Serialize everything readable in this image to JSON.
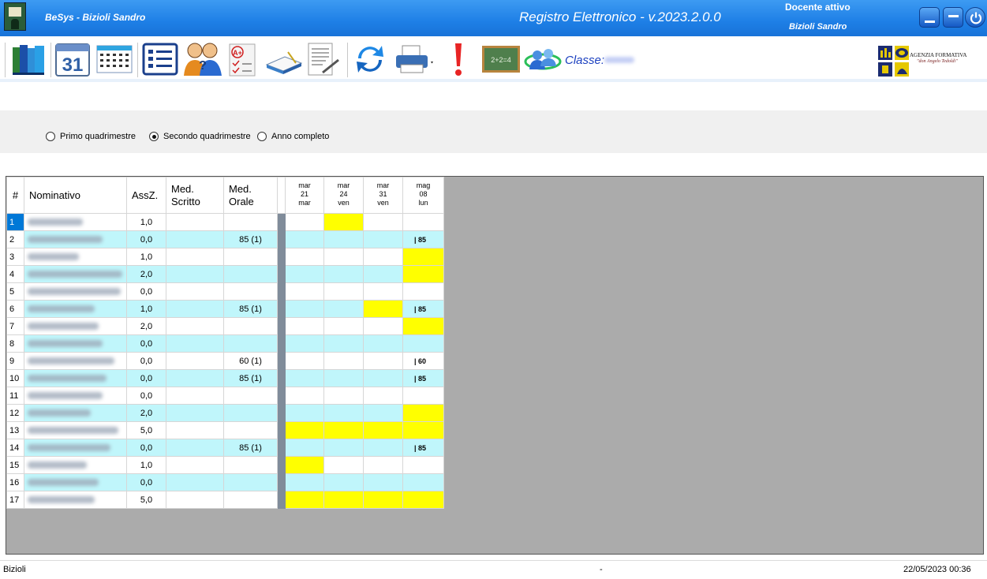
{
  "titlebar": {
    "app_name": "BeSys - Bizioli Sandro",
    "title": "Registro Elettronico - v.2023.2.0.0",
    "teacher_label": "Docente attivo",
    "teacher_name": "Bizioli Sandro"
  },
  "toolbar": {
    "icons": [
      "books-icon",
      "calendar-icon",
      "timetable-icon",
      "register-icon",
      "students-icon",
      "grades-icon",
      "open-book-icon",
      "document-sign-icon",
      "sync-icon",
      "printer-icon",
      "alert-icon",
      "blackboard-icon",
      "globe-users-icon"
    ],
    "calendar_day": "31",
    "blackboard_text": "2+2=4",
    "class_label": "Classe:",
    "org_name": "AGENZIA FORMATIVA",
    "org_subtitle": "\"don Angelo Tedoldi\""
  },
  "filters": {
    "options": [
      {
        "label": "Primo quadrimestre",
        "selected": false
      },
      {
        "label": "Secondo quadrimestre",
        "selected": true
      },
      {
        "label": "Anno completo",
        "selected": false
      }
    ]
  },
  "grid": {
    "headers": {
      "num": "#",
      "name": "Nominativo",
      "absences": "AssZ.",
      "written_1": "Med.",
      "written_2": "Scritto",
      "oral_1": "Med.",
      "oral_2": "Orale"
    },
    "dates": [
      {
        "month": "mar",
        "day": "21",
        "weekday": "mar"
      },
      {
        "month": "mar",
        "day": "24",
        "weekday": "ven"
      },
      {
        "month": "mar",
        "day": "31",
        "weekday": "ven"
      },
      {
        "month": "mag",
        "day": "08",
        "weekday": "lun"
      }
    ],
    "rows": [
      {
        "num": "1",
        "abs": "1,0",
        "written": "",
        "oral": "",
        "cells": [
          "",
          "Y",
          "",
          ""
        ]
      },
      {
        "num": "2",
        "abs": "0,0",
        "written": "",
        "oral": "85 (1)",
        "cells": [
          "",
          "",
          "",
          "| 85"
        ]
      },
      {
        "num": "3",
        "abs": "1,0",
        "written": "",
        "oral": "",
        "cells": [
          "",
          "",
          "",
          "Y"
        ]
      },
      {
        "num": "4",
        "abs": "2,0",
        "written": "",
        "oral": "",
        "cells": [
          "",
          "",
          "",
          "Y"
        ]
      },
      {
        "num": "5",
        "abs": "0,0",
        "written": "",
        "oral": "",
        "cells": [
          "",
          "",
          "",
          ""
        ]
      },
      {
        "num": "6",
        "abs": "1,0",
        "written": "",
        "oral": "85 (1)",
        "cells": [
          "",
          "",
          "Y",
          "| 85"
        ]
      },
      {
        "num": "7",
        "abs": "2,0",
        "written": "",
        "oral": "",
        "cells": [
          "",
          "",
          "",
          "Y"
        ]
      },
      {
        "num": "8",
        "abs": "0,0",
        "written": "",
        "oral": "",
        "cells": [
          "",
          "",
          "",
          ""
        ]
      },
      {
        "num": "9",
        "abs": "0,0",
        "written": "",
        "oral": "60 (1)",
        "cells": [
          "",
          "",
          "",
          "| 60"
        ]
      },
      {
        "num": "10",
        "abs": "0,0",
        "written": "",
        "oral": "85 (1)",
        "cells": [
          "",
          "",
          "",
          "| 85"
        ]
      },
      {
        "num": "11",
        "abs": "0,0",
        "written": "",
        "oral": "",
        "cells": [
          "",
          "",
          "",
          ""
        ]
      },
      {
        "num": "12",
        "abs": "2,0",
        "written": "",
        "oral": "",
        "cells": [
          "",
          "",
          "",
          "Y"
        ]
      },
      {
        "num": "13",
        "abs": "5,0",
        "written": "",
        "oral": "",
        "cells": [
          "Y",
          "Y",
          "Y",
          "Y"
        ]
      },
      {
        "num": "14",
        "abs": "0,0",
        "written": "",
        "oral": "85 (1)",
        "cells": [
          "",
          "",
          "",
          "| 85"
        ]
      },
      {
        "num": "15",
        "abs": "1,0",
        "written": "",
        "oral": "",
        "cells": [
          "Y",
          "",
          "",
          ""
        ]
      },
      {
        "num": "16",
        "abs": "0,0",
        "written": "",
        "oral": "",
        "cells": [
          "",
          "",
          "",
          ""
        ]
      },
      {
        "num": "17",
        "abs": "5,0",
        "written": "",
        "oral": "",
        "cells": [
          "Y",
          "Y",
          "Y",
          "Y"
        ]
      }
    ]
  },
  "colors": {
    "titlebar": "#1e7fe6",
    "row_alt": "#c0f6fb",
    "absence_highlight": "#ffff00",
    "selected_row": "#0078d7"
  },
  "statusbar": {
    "user": "Bizioli",
    "middle": "-",
    "datetime": "22/05/2023  00:36"
  }
}
